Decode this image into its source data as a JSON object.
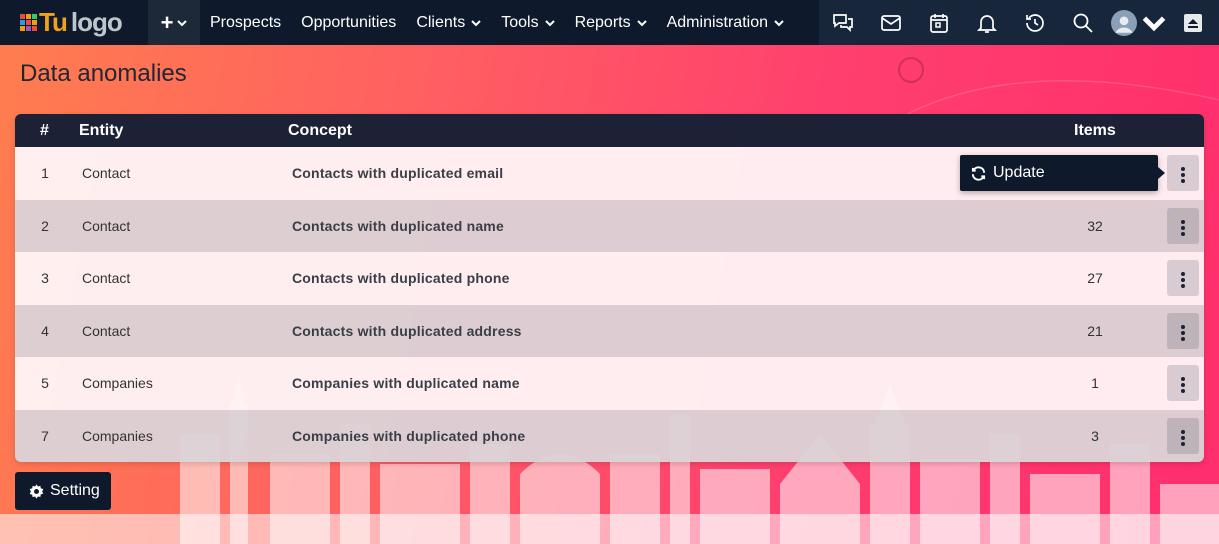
{
  "brand": {
    "logo_tu": "Tu",
    "logo_text": "logo"
  },
  "nav": {
    "plus_label": "+",
    "items": [
      {
        "label": "Prospects",
        "has_caret": false
      },
      {
        "label": "Opportunities",
        "has_caret": false
      },
      {
        "label": "Clients",
        "has_caret": true
      },
      {
        "label": "Tools",
        "has_caret": true
      },
      {
        "label": "Reports",
        "has_caret": true
      },
      {
        "label": "Administration",
        "has_caret": true
      }
    ],
    "icons": [
      "chat-icon",
      "mail-icon",
      "calendar-icon",
      "bell-icon",
      "history-icon",
      "search-icon",
      "avatar",
      "upload-icon"
    ]
  },
  "page": {
    "title": "Data anomalies"
  },
  "table": {
    "headers": {
      "num": "#",
      "entity": "Entity",
      "concept": "Concept",
      "items": "Items"
    },
    "rows": [
      {
        "num": "1",
        "entity": "Contact",
        "concept": "Contacts with duplicated email",
        "items": ""
      },
      {
        "num": "2",
        "entity": "Contact",
        "concept": "Contacts with duplicated name",
        "items": "32"
      },
      {
        "num": "3",
        "entity": "Contact",
        "concept": "Contacts with duplicated phone",
        "items": "27"
      },
      {
        "num": "4",
        "entity": "Contact",
        "concept": "Contacts with duplicated address",
        "items": "21"
      },
      {
        "num": "5",
        "entity": "Companies",
        "concept": "Companies with duplicated name",
        "items": "1"
      },
      {
        "num": "7",
        "entity": "Companies",
        "concept": "Companies with duplicated phone",
        "items": "3"
      }
    ]
  },
  "popup": {
    "update_label": "Update"
  },
  "footer": {
    "setting_label": "Setting"
  },
  "colors": {
    "nav_bg": "#0e1a2b",
    "header_bg": "#1c2135",
    "accent_orange": "#f0a21a"
  }
}
